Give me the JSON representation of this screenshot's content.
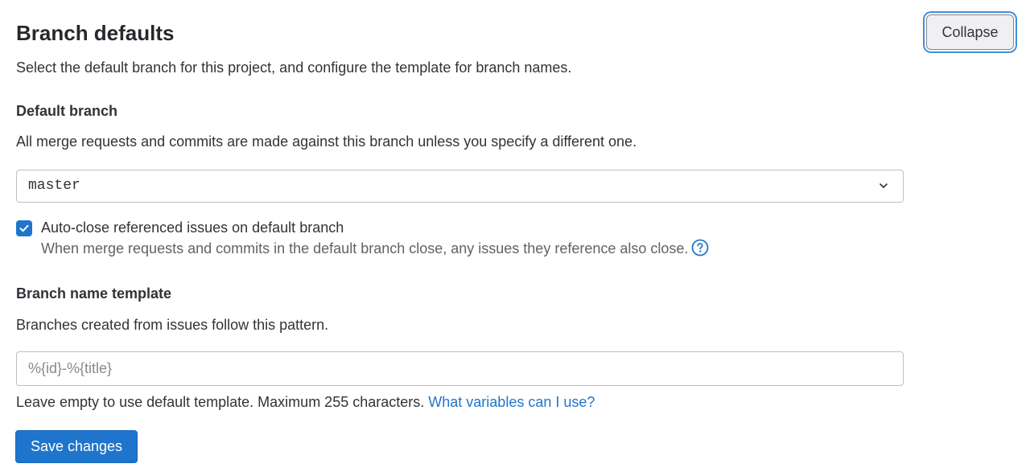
{
  "header": {
    "title": "Branch defaults",
    "collapse_label": "Collapse",
    "description": "Select the default branch for this project, and configure the template for branch names."
  },
  "default_branch": {
    "label": "Default branch",
    "help": "All merge requests and commits are made against this branch unless you specify a different one.",
    "selected": "master",
    "select_icon": "chevron-down-icon"
  },
  "auto_close": {
    "checked": true,
    "label": "Auto-close referenced issues on default branch",
    "help": "When merge requests and commits in the default branch close, any issues they reference also close.",
    "help_icon": "question-circle-icon"
  },
  "branch_name_template": {
    "label": "Branch name template",
    "help": "Branches created from issues follow this pattern.",
    "input_value": "",
    "placeholder": "%{id}-%{title}",
    "hint": "Leave empty to use default template. Maximum 255 characters.",
    "hint_link": "What variables can I use?"
  },
  "actions": {
    "save_label": "Save changes"
  },
  "colors": {
    "primary": "#1f75cb",
    "text": "#333238",
    "muted": "#626168",
    "border": "#bfbfc3"
  }
}
